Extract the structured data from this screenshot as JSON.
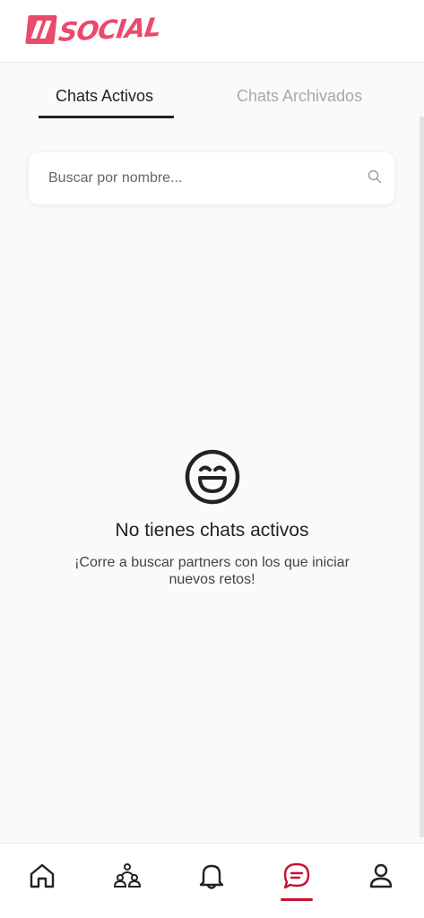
{
  "app": {
    "logo_text": "SOCIAL",
    "brand_color": "#ea4a6b",
    "active_color": "#c8102e"
  },
  "tabs": [
    {
      "label": "Chats Activos",
      "active": true
    },
    {
      "label": "Chats Archivados",
      "active": false
    }
  ],
  "search": {
    "placeholder": "Buscar por nombre...",
    "value": "",
    "icon": "search-icon"
  },
  "empty_state": {
    "icon": "laughing-face-icon",
    "title": "No tienes chats activos",
    "message": "¡Corre a buscar partners con los que iniciar nuevos retos!"
  },
  "bottom_nav": [
    {
      "name": "home",
      "icon": "home-icon",
      "active": false
    },
    {
      "name": "community",
      "icon": "community-icon",
      "active": false
    },
    {
      "name": "notifications",
      "icon": "bell-icon",
      "active": false
    },
    {
      "name": "chats",
      "icon": "chat-icon",
      "active": true
    },
    {
      "name": "profile",
      "icon": "user-icon",
      "active": false
    }
  ]
}
